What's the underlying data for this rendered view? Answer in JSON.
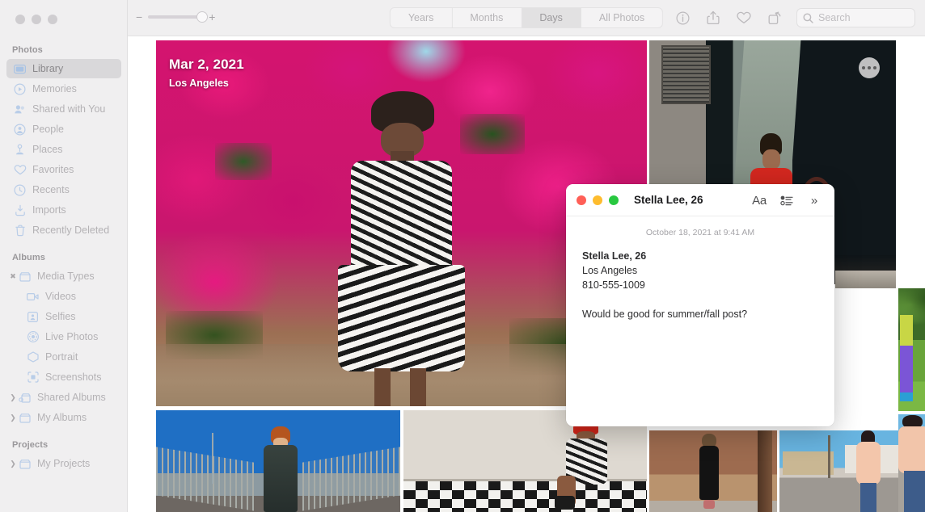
{
  "window": {
    "title": "Photos",
    "traffic_lights": [
      "close",
      "minimize",
      "zoom"
    ]
  },
  "toolbar": {
    "zoom_minus": "−",
    "zoom_plus": "+",
    "segments": [
      {
        "label": "Years",
        "active": false
      },
      {
        "label": "Months",
        "active": false
      },
      {
        "label": "Days",
        "active": true
      },
      {
        "label": "All Photos",
        "active": false
      }
    ],
    "actions": [
      {
        "name": "info-icon",
        "label": "Info"
      },
      {
        "name": "share-icon",
        "label": "Share"
      },
      {
        "name": "favorite-heart-icon",
        "label": "Favorite"
      },
      {
        "name": "rotate-icon",
        "label": "Rotate"
      }
    ],
    "search": {
      "placeholder": "Search",
      "value": ""
    }
  },
  "sidebar": {
    "groups": [
      {
        "title": "Photos",
        "items": [
          {
            "label": "Library",
            "icon": "library-icon",
            "selected": true
          },
          {
            "label": "Memories",
            "icon": "memories-icon",
            "selected": false
          },
          {
            "label": "Shared with You",
            "icon": "shared-with-you-icon",
            "selected": false
          },
          {
            "label": "People",
            "icon": "people-icon",
            "selected": false
          },
          {
            "label": "Places",
            "icon": "places-icon",
            "selected": false
          },
          {
            "label": "Favorites",
            "icon": "heart-icon",
            "selected": false
          },
          {
            "label": "Recents",
            "icon": "clock-icon",
            "selected": false
          },
          {
            "label": "Imports",
            "icon": "import-icon",
            "selected": false
          },
          {
            "label": "Recently Deleted",
            "icon": "trash-icon",
            "selected": false
          }
        ]
      },
      {
        "title": "Albums",
        "items": [
          {
            "label": "Media Types",
            "icon": "folder-icon",
            "disclosure": "expanded",
            "selected": false
          },
          {
            "label": "Videos",
            "icon": "video-icon",
            "indent": true,
            "selected": false
          },
          {
            "label": "Selfies",
            "icon": "selfie-icon",
            "indent": true,
            "selected": false
          },
          {
            "label": "Live Photos",
            "icon": "live-photo-icon",
            "indent": true,
            "selected": false
          },
          {
            "label": "Portrait",
            "icon": "portrait-icon",
            "indent": true,
            "selected": false
          },
          {
            "label": "Screenshots",
            "icon": "screenshot-icon",
            "indent": true,
            "selected": false
          },
          {
            "label": "Shared Albums",
            "icon": "shared-folder-icon",
            "disclosure": "collapsed",
            "selected": false
          },
          {
            "label": "My Albums",
            "icon": "folder-icon",
            "disclosure": "collapsed",
            "selected": false
          }
        ]
      },
      {
        "title": "Projects",
        "items": [
          {
            "label": "My Projects",
            "icon": "folder-icon",
            "disclosure": "collapsed",
            "selected": false
          }
        ]
      }
    ]
  },
  "grid": {
    "hero": {
      "date": "Mar 2, 2021",
      "location": "Los Angeles"
    },
    "more_button": "more-options-button"
  },
  "note": {
    "title": "Stella Lee, 26",
    "timestamp": "October 18, 2021 at 9:41 AM",
    "actions": [
      {
        "name": "format-aa-button",
        "label": "Aa"
      },
      {
        "name": "checklist-button",
        "label": ""
      },
      {
        "name": "expand-chevrons-button",
        "label": "»"
      }
    ],
    "body": {
      "name": "Stella Lee, 26",
      "city": "Los Angeles",
      "phone": "810-555-1009",
      "note_text": "Would be good for summer/fall post?"
    },
    "traffic_lights": {
      "close": "#ff5f57",
      "minimize": "#febc2e",
      "zoom": "#28c840"
    }
  },
  "colors": {
    "sidebar_bg": "#f0eff0",
    "toolbar_bg": "#f0eff0",
    "selected_row": "#d9d8da",
    "icon_blue": "#b9cde8"
  }
}
